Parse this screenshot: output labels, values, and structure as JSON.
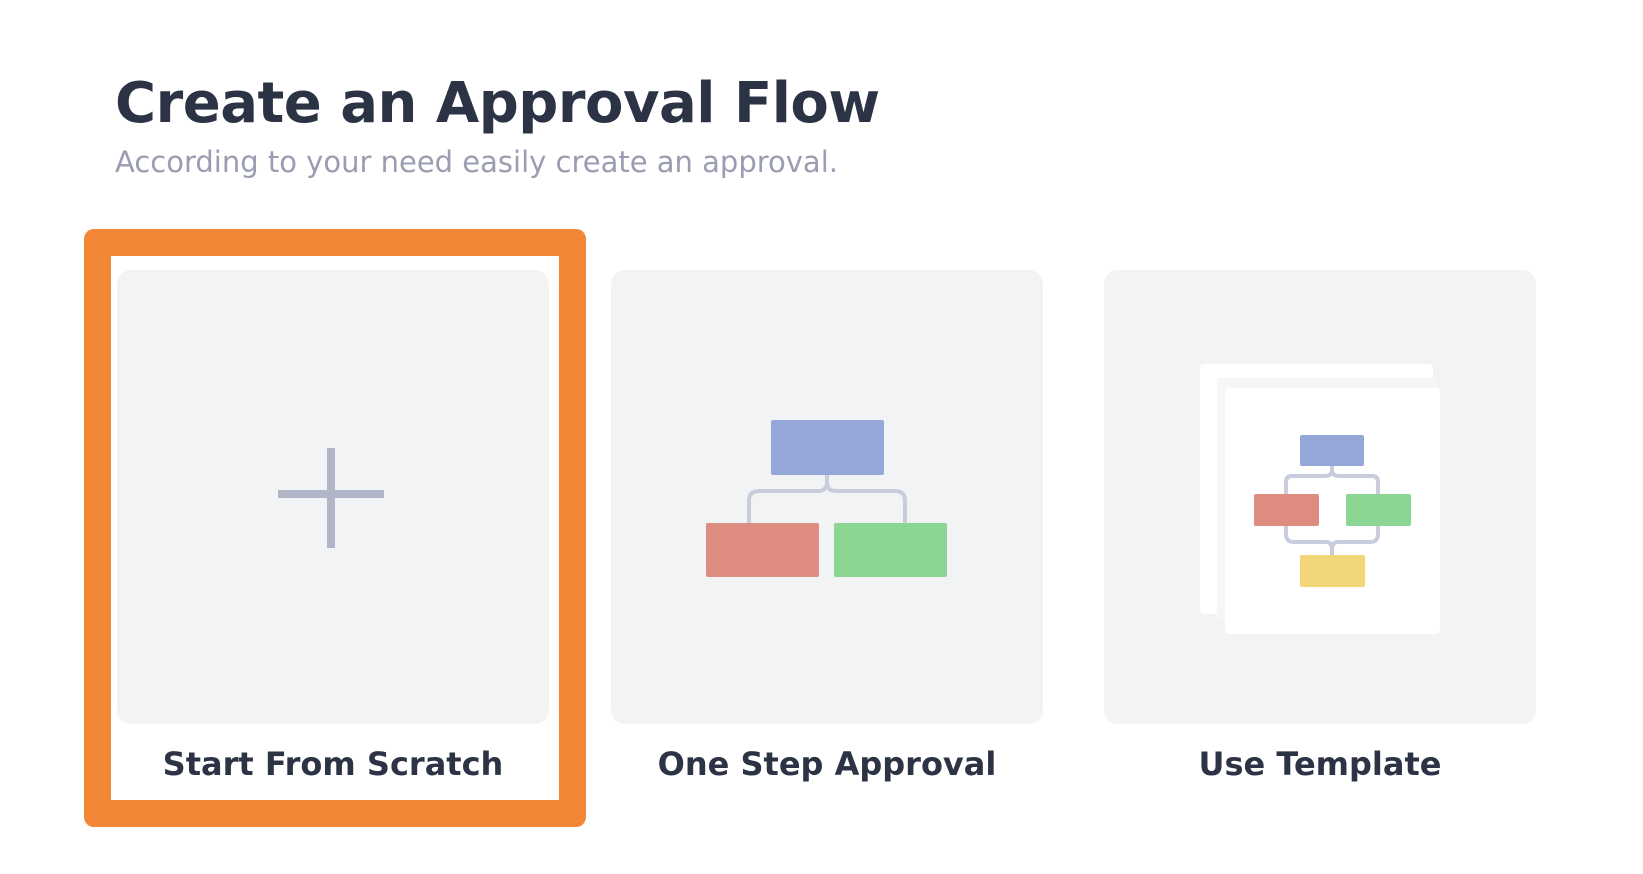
{
  "page": {
    "title": "Create an Approval Flow",
    "subtitle": "According to your need easily create an approval."
  },
  "options": [
    {
      "label": "Start From Scratch",
      "icon": "plus-icon",
      "selected": true
    },
    {
      "label": "One Step Approval",
      "icon": "flowchart-icon",
      "selected": false
    },
    {
      "label": "Use Template",
      "icon": "template-stack-icon",
      "selected": false
    }
  ],
  "colors": {
    "heading": "#2c3345",
    "subtitle": "#9a9db1",
    "card_background": "#f2f3f5",
    "highlight": "#f28835",
    "node_blue": "#95a6d8",
    "node_red": "#de8b80",
    "node_green": "#8ad692",
    "node_yellow": "#f2d576",
    "connector": "#c9ccdc",
    "plus": "#b0b6c8"
  }
}
